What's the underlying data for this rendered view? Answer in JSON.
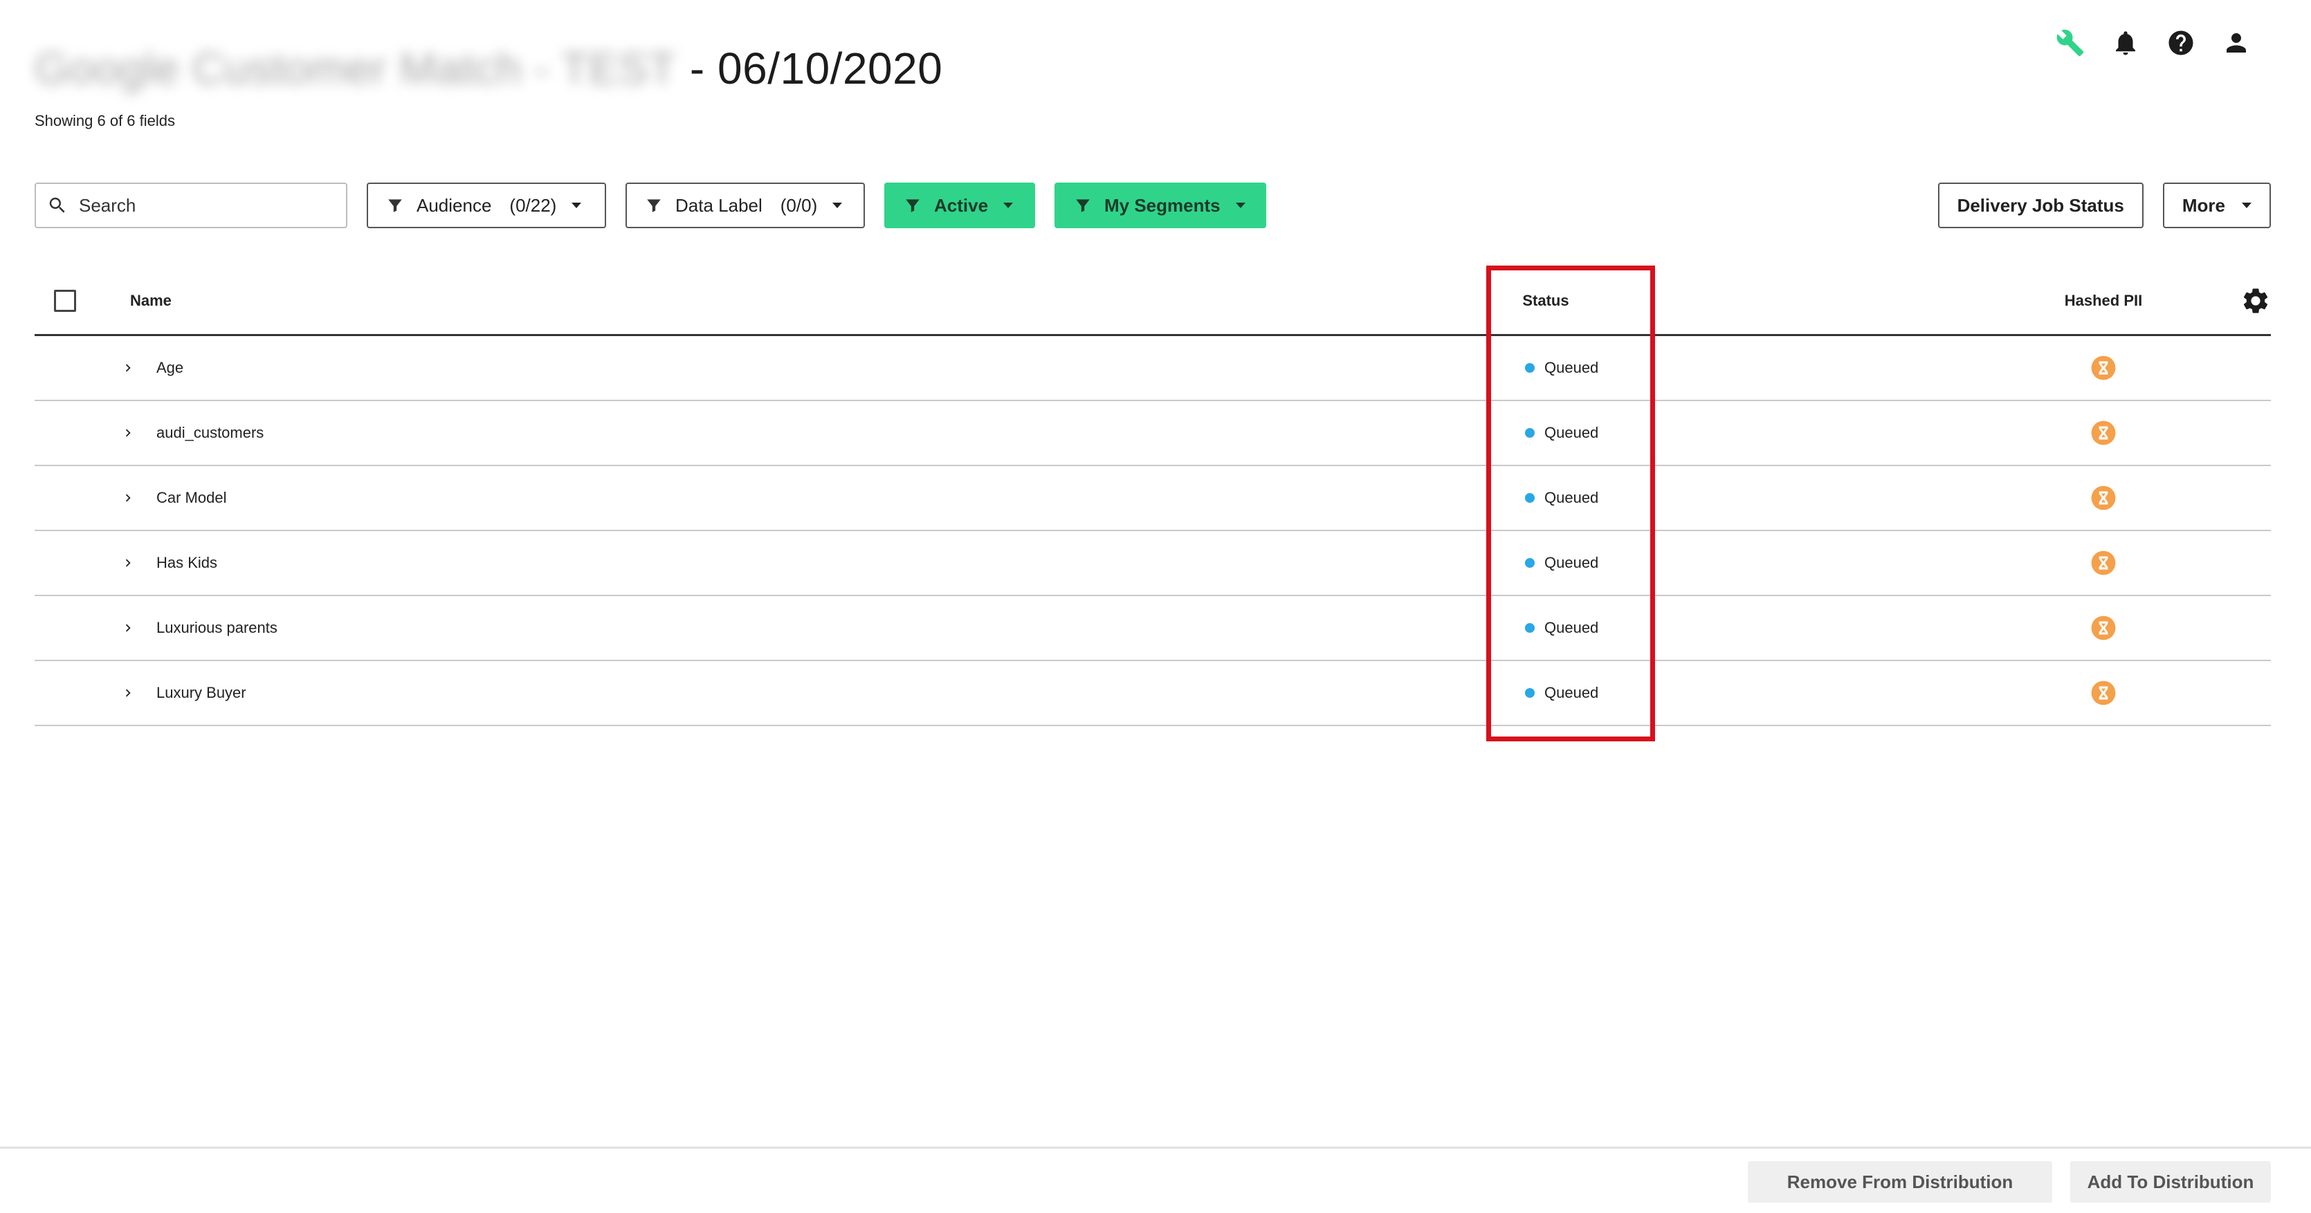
{
  "header": {
    "title_blurred": "Google Customer Match - TEST",
    "title_date": "- 06/10/2020",
    "subtitle": "Showing 6 of 6 fields"
  },
  "top_icons": [
    {
      "name": "wrench-icon",
      "color": "#2fd48a"
    },
    {
      "name": "bell-icon"
    },
    {
      "name": "help-icon"
    },
    {
      "name": "user-icon"
    }
  ],
  "filters": {
    "search_placeholder": "Search",
    "audience_label": "Audience",
    "audience_count": "(0/22)",
    "datalabel_label": "Data Label",
    "datalabel_count": "(0/0)",
    "active_label": "Active",
    "segments_label": "My Segments",
    "delivery_label": "Delivery Job Status",
    "more_label": "More"
  },
  "table": {
    "col_name": "Name",
    "col_status": "Status",
    "col_pii": "Hashed PII",
    "rows": [
      {
        "name": "Age",
        "status": "Queued"
      },
      {
        "name": "audi_customers",
        "status": "Queued"
      },
      {
        "name": "Car Model",
        "status": "Queued"
      },
      {
        "name": "Has Kids",
        "status": "Queued"
      },
      {
        "name": "Luxurious parents",
        "status": "Queued"
      },
      {
        "name": "Luxury Buyer",
        "status": "Queued"
      }
    ]
  },
  "footer": {
    "remove_label": "Remove From Distribution",
    "add_label": "Add To Distribution"
  },
  "colors": {
    "accent_green": "#2fd48a",
    "status_dot": "#29a7e6",
    "pii_orange": "#f5a04a",
    "highlight_red": "#d8101c"
  }
}
